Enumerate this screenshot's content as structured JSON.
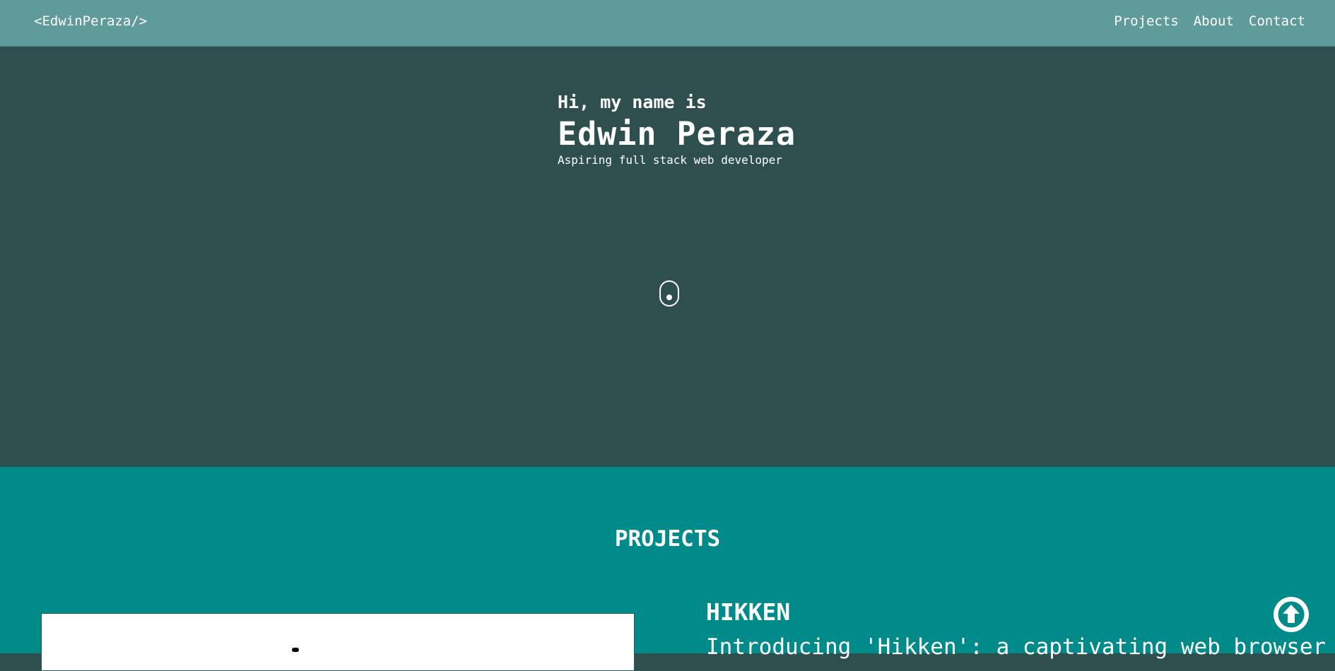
{
  "nav": {
    "brand": "<EdwinPeraza/>",
    "links": [
      "Projects",
      "About",
      "Contact"
    ]
  },
  "hero": {
    "greeting": "Hi, my name is",
    "name": "Edwin Peraza",
    "tagline": "Aspiring full stack web developer",
    "scroll_icon": "mouse-scroll-icon"
  },
  "projects": {
    "heading": "PROJECTS",
    "items": [
      {
        "title": "HIKKEN",
        "description": "Introducing 'Hikken': a captivating web browser"
      }
    ]
  },
  "back_to_top_icon": "arrow-up-circle-icon",
  "colors": {
    "navbar": "#5f9b9a",
    "hero": "#2f4f4f",
    "projects": "#008b8a"
  }
}
